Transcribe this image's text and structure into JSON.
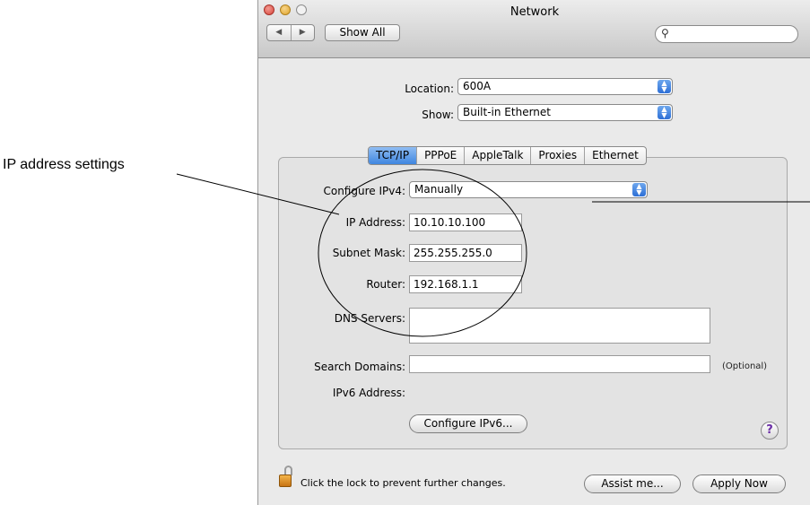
{
  "callout": {
    "text": "IP address settings"
  },
  "window": {
    "title": "Network"
  },
  "toolbar": {
    "back_label": "◀",
    "forward_label": "▶",
    "show_all_label": "Show All",
    "search_placeholder": "",
    "search_icon": "🔍"
  },
  "location": {
    "label": "Location:",
    "value": "600A"
  },
  "show": {
    "label": "Show:",
    "value": "Built-in Ethernet"
  },
  "tabs": [
    {
      "label": "TCP/IP",
      "active": true
    },
    {
      "label": "PPPoE",
      "active": false
    },
    {
      "label": "AppleTalk",
      "active": false
    },
    {
      "label": "Proxies",
      "active": false
    },
    {
      "label": "Ethernet",
      "active": false
    }
  ],
  "tcpip": {
    "configure_label": "Configure IPv4:",
    "configure_value": "Manually",
    "ip_label": "IP Address:",
    "ip_value": "10.10.10.100",
    "subnet_label": "Subnet Mask:",
    "subnet_value": "255.255.255.0",
    "router_label": "Router:",
    "router_value": "192.168.1.1",
    "dns_label": "DNS Servers:",
    "dns_value": "",
    "search_label": "Search Domains:",
    "search_value": "",
    "optional_label": "(Optional)",
    "ipv6_label": "IPv6 Address:",
    "configure_ipv6_button": "Configure IPv6..."
  },
  "help": {
    "label": "?"
  },
  "footer": {
    "lock_text": "Click the lock to prevent further changes.",
    "assist_button": "Assist me...",
    "apply_button": "Apply Now"
  },
  "colors": {
    "accent": "#3f86e0",
    "window_bg": "#eaeaea",
    "help_mark": "#6b2ea6"
  }
}
